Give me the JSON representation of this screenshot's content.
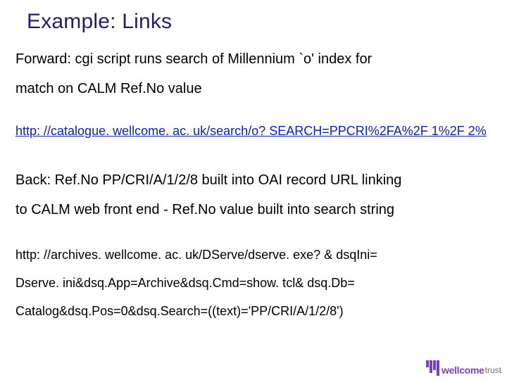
{
  "title": "Example: Links",
  "forward_line1": "Forward:  cgi script runs search of Millennium `o' index for",
  "forward_line2": "match on CALM Ref.No value",
  "forward_link": "http: //catalogue. wellcome. ac. uk/search/o? SEARCH=PPCRI%2FA%2F 1%2F 2%",
  "back_line1": "Back:  Ref.No PP/CRI/A/1/2/8 built into OAI record URL linking",
  "back_line2": "to CALM web front end - Ref.No value built into search string",
  "back_url1": "http: //archives. wellcome. ac. uk/DServe/dserve. exe? & dsqIni=",
  "back_url2": "Dserve. ini&dsq.App=Archive&dsq.Cmd=show. tcl& dsq.Db=",
  "back_url3": "Catalog&dsq.Pos=0&dsq.Search=((text)='PP/CRI/A/1/2/8')",
  "logo_word": "wellcome",
  "logo_trust": "trust"
}
